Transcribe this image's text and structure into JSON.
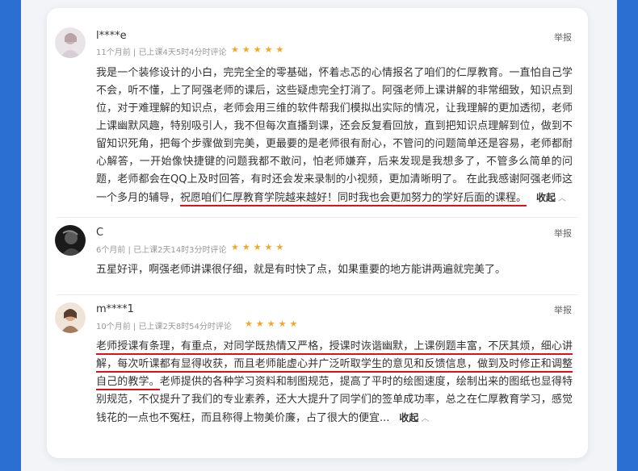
{
  "reviews": [
    {
      "username": "l****e",
      "meta": "11个月前 | 已上课4天5时4分时评论",
      "stars": "★★★★★",
      "report": "举报",
      "text_plain": "我是一个装修设计的小白，完完全全的零基础，怀着忐忑的心情报名了咱们的仁厚教育。一直怕自己学不会，听不懂，上了阿强老师的课后，这些疑虑完全打消了。阿强老师上课讲解的非常细致，知识点到位，对于难理解的知识点，老师会用三维的软件帮我们模拟出实际的情况，让我理解的更加透彻，老师上课幽默风趣，特别吸引人，我不但每次直播到课，还会反复看回放，直到把知识点理解到位，做到不留知识死角，把每个步骤做到完美，更最要的是老师很有耐心，不管问的问题简单还是容易，老师都耐心解答，一开始像快捷键的问题我都不敢问，怕老师嫌弃，后来发现是我想多了，不管多么简单的问题，老师都会在QQ上及时回答，有时还会发来录制的小视频，更加清晰明了。 在此我感谢阿强老师这一个多月的辅导，",
      "text_highlight": "祝愿咱们仁厚教育学院越来越好！同时我也会更加努力的学好后面的课程。",
      "fold": "收起"
    },
    {
      "username": "C",
      "meta": "6个月前 | 已上课2天14时3分时评论",
      "stars": "★★★★★",
      "report": "举报",
      "text_plain": "五星好评，啊强老师讲课很仔细，就是有时快了点，如果重要的地方能讲两遍就完美了。"
    },
    {
      "username": "m****1",
      "meta": "10个月前 | 已上课2天8时54分时评论",
      "stars": "★★★★★",
      "report": "举报",
      "text_highlight": "老师授课有条理，有重点，对同学既热情又严格，授课时诙谐幽默，上课例题丰富，不厌其烦，细心讲解，每次听课都有显得收获，而且老师能虚心并广泛听取学生的意见和反馈信息，做到及时修正和调整自己的教学。",
      "text_plain": "老师提供的各种学习资料和制图规范，提高了平时的绘图速度，绘制出来的图纸也显得特别规范，不仅提升了我们的专业素养，还大大提升了同学们的签单成功率，总之在仁厚教育学习，感觉钱花的一点也不冤枉，而且称得上物美价廉，占了很大的便宜...",
      "fold": "收起"
    }
  ],
  "colors": {
    "accent_side": "#2b6fd3",
    "star": "#f5a623",
    "underline": "#e0101a"
  },
  "icons": {
    "chevron": "chevron-up-icon"
  }
}
